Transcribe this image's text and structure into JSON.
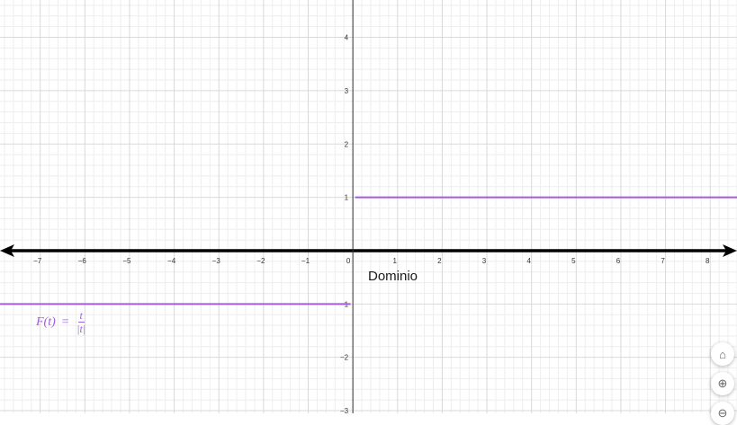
{
  "chart_data": {
    "type": "line",
    "x_ticks": [
      "-7",
      "-6",
      "-5",
      "-4",
      "-3",
      "-2",
      "-1",
      "0",
      "1",
      "2",
      "3",
      "4",
      "5",
      "6",
      "7",
      "8"
    ],
    "y_ticks": [
      "4",
      "3",
      "2",
      "1",
      "-1",
      "-2",
      "-3"
    ],
    "xlim": [
      -7.9,
      8.6
    ],
    "ylim": [
      -3.05,
      4.7
    ],
    "grid": true,
    "xlabel": "Dominio",
    "series": [
      {
        "name": "F(t) = t/|t|",
        "segments": [
          {
            "x": [
              -7.9,
              -0.05
            ],
            "y": [
              -1,
              -1
            ]
          },
          {
            "x": [
              0.05,
              8.6
            ],
            "y": [
              1,
              1
            ]
          }
        ]
      }
    ],
    "colors": {
      "function": "#a35be0",
      "axis": "#000000",
      "grid_major": "#d9d9d9",
      "grid_minor": "#eeeeee"
    }
  },
  "formula": {
    "lhs": "F(t)",
    "eq": "=",
    "num": "t",
    "den": "|t|"
  },
  "controls": {
    "home_icon": "⌂",
    "zoom_icon": "⊕",
    "zoom_out_icon": "⊖"
  }
}
